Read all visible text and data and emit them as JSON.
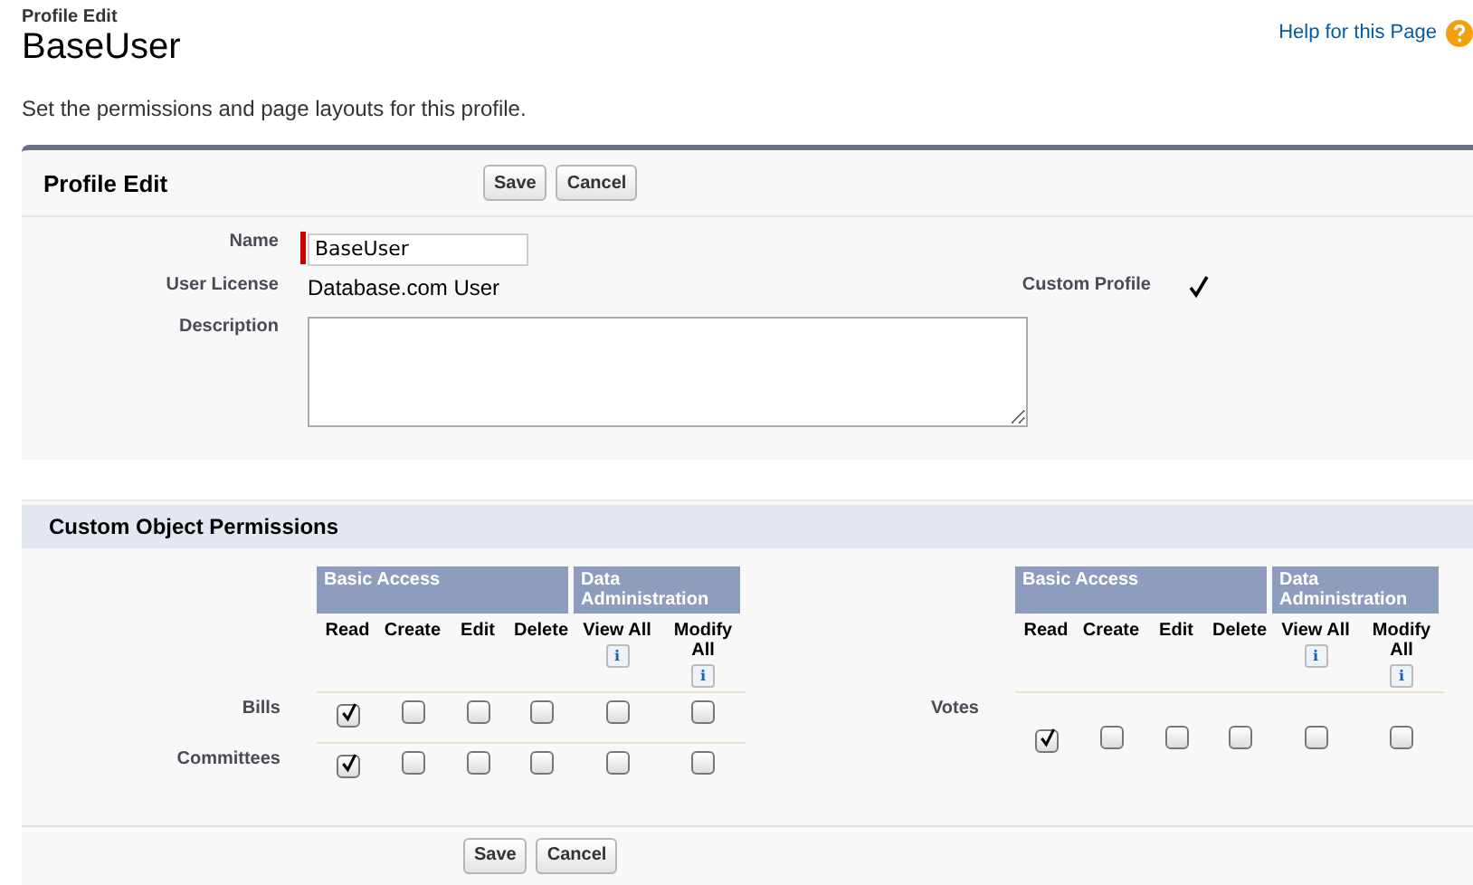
{
  "breadcrumb": "Profile Edit",
  "title": "BaseUser",
  "help_link": "Help for this Page",
  "intro": "Set the permissions and page layouts for this profile.",
  "profile_edit": {
    "heading": "Profile Edit",
    "buttons": [
      "Save",
      "Cancel"
    ],
    "name": {
      "label": "Name",
      "value": "BaseUser"
    },
    "user_license": {
      "label": "User License",
      "value": "Database.com User"
    },
    "custom_profile": {
      "label": "Custom Profile",
      "checked": true
    },
    "description": {
      "label": "Description"
    }
  },
  "custom_object_permissions": {
    "heading": "Custom Object Permissions",
    "tables": [
      {
        "groups": [
          {
            "label": "Basic Access",
            "columns": [
              {
                "label": "Read"
              },
              {
                "label": "Create"
              },
              {
                "label": "Edit"
              },
              {
                "label": "Delete"
              }
            ]
          },
          {
            "label": "Data Administration",
            "columns": [
              {
                "label": "View All",
                "info": "i"
              },
              {
                "label": "Modify All",
                "info": "i"
              }
            ]
          }
        ],
        "rows": [
          {
            "name": "Bills",
            "cells": [
              {
                "checked": true
              },
              {
                "checked": false
              },
              {
                "checked": false
              },
              {
                "checked": false
              },
              {
                "checked": false
              },
              {
                "checked": false
              }
            ]
          },
          {
            "name": "Committees",
            "cells": [
              {
                "checked": true
              },
              {
                "checked": false
              },
              {
                "checked": false
              },
              {
                "checked": false
              },
              {
                "checked": false
              },
              {
                "checked": false
              }
            ]
          }
        ]
      },
      {
        "groups": [
          {
            "label": "Basic Access",
            "columns": [
              {
                "label": "Read"
              },
              {
                "label": "Create"
              },
              {
                "label": "Edit"
              },
              {
                "label": "Delete"
              }
            ]
          },
          {
            "label": "Data Administration",
            "columns": [
              {
                "label": "View All",
                "info": "i"
              },
              {
                "label": "Modify All",
                "info": "i"
              }
            ]
          }
        ],
        "rows": [
          {
            "name": "Votes",
            "cells": [
              {
                "checked": true
              },
              {
                "checked": false
              },
              {
                "checked": false
              },
              {
                "checked": false
              },
              {
                "checked": false
              },
              {
                "checked": false
              }
            ]
          }
        ]
      }
    ]
  },
  "footer_buttons": [
    "Save",
    "Cancel"
  ]
}
